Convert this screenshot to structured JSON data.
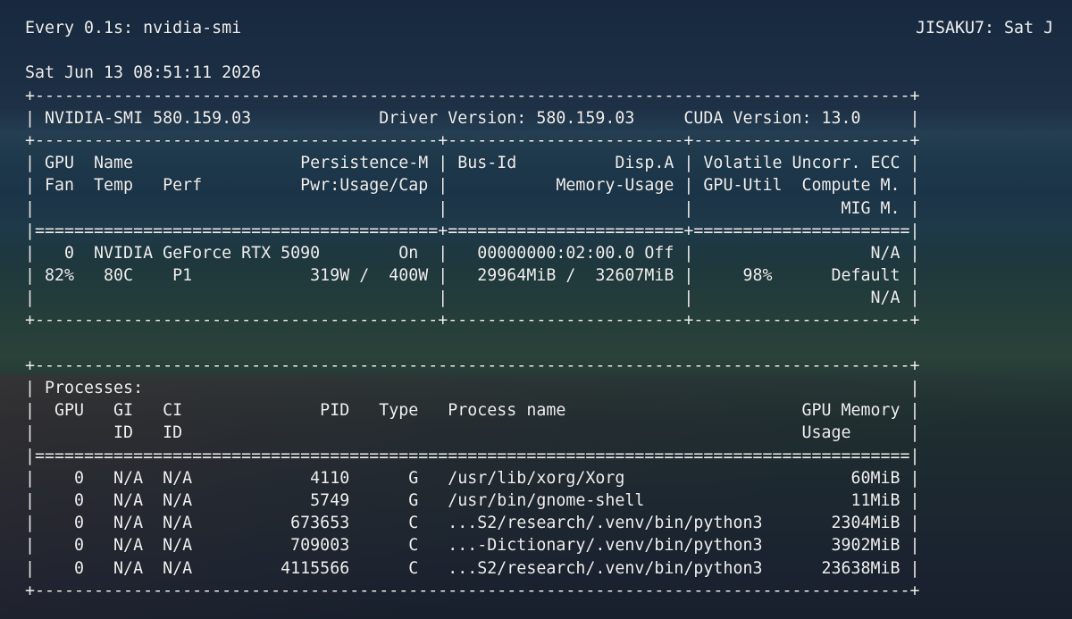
{
  "watch": {
    "command": "Every 0.1s: nvidia-smi",
    "host_time": "JISAKU7: Sat J",
    "timestamp": "Sat Jun 13 08:51:11 2026"
  },
  "smi_header": {
    "line": "| NVIDIA-SMI 580.159.03             Driver Version: 580.159.03     CUDA Version: 13.0     |"
  },
  "gpu_table": {
    "border_top": "+-----------------------------------------------------------------------------------------+",
    "sep_after_header": "+-----------------------------------------+------------------------+----------------------+",
    "col_header_1": "| GPU  Name                 Persistence-M | Bus-Id          Disp.A | Volatile Uncorr. ECC |",
    "col_header_2": "| Fan  Temp   Perf          Pwr:Usage/Cap |           Memory-Usage | GPU-Util  Compute M. |",
    "col_header_3": "|                                         |                        |               MIG M. |",
    "double_rule": "|=========================================+========================+======================|",
    "row_1": "|   0  NVIDIA GeForce RTX 5090        On  |   00000000:02:00.0 Off |                  N/A |",
    "row_2": "| 82%   80C    P1            319W /  400W |   29964MiB /  32607MiB |     98%      Default |",
    "row_3": "|                                         |                        |                  N/A |",
    "border_bottom": "+-----------------------------------------+------------------------+----------------------+"
  },
  "processes": {
    "border_top": "+-----------------------------------------------------------------------------------------+",
    "title": "| Processes:                                                                              |",
    "header_1": "|  GPU   GI   CI              PID   Type   Process name                        GPU Memory |",
    "header_2": "|        ID   ID                                                               Usage      |",
    "double_rule": "|=========================================================================================|",
    "rows": [
      "|    0   N/A  N/A            4110      G   /usr/lib/xorg/Xorg                       60MiB |",
      "|    0   N/A  N/A            5749      G   /usr/bin/gnome-shell                     11MiB |",
      "|    0   N/A  N/A          673653      C   ...S2/research/.venv/bin/python3       2304MiB |",
      "|    0   N/A  N/A          709003      C   ...-Dictionary/.venv/bin/python3       3902MiB |",
      "|    0   N/A  N/A         4115566      C   ...S2/research/.venv/bin/python3      23638MiB |"
    ],
    "border_bottom": "+-----------------------------------------------------------------------------------------+"
  }
}
